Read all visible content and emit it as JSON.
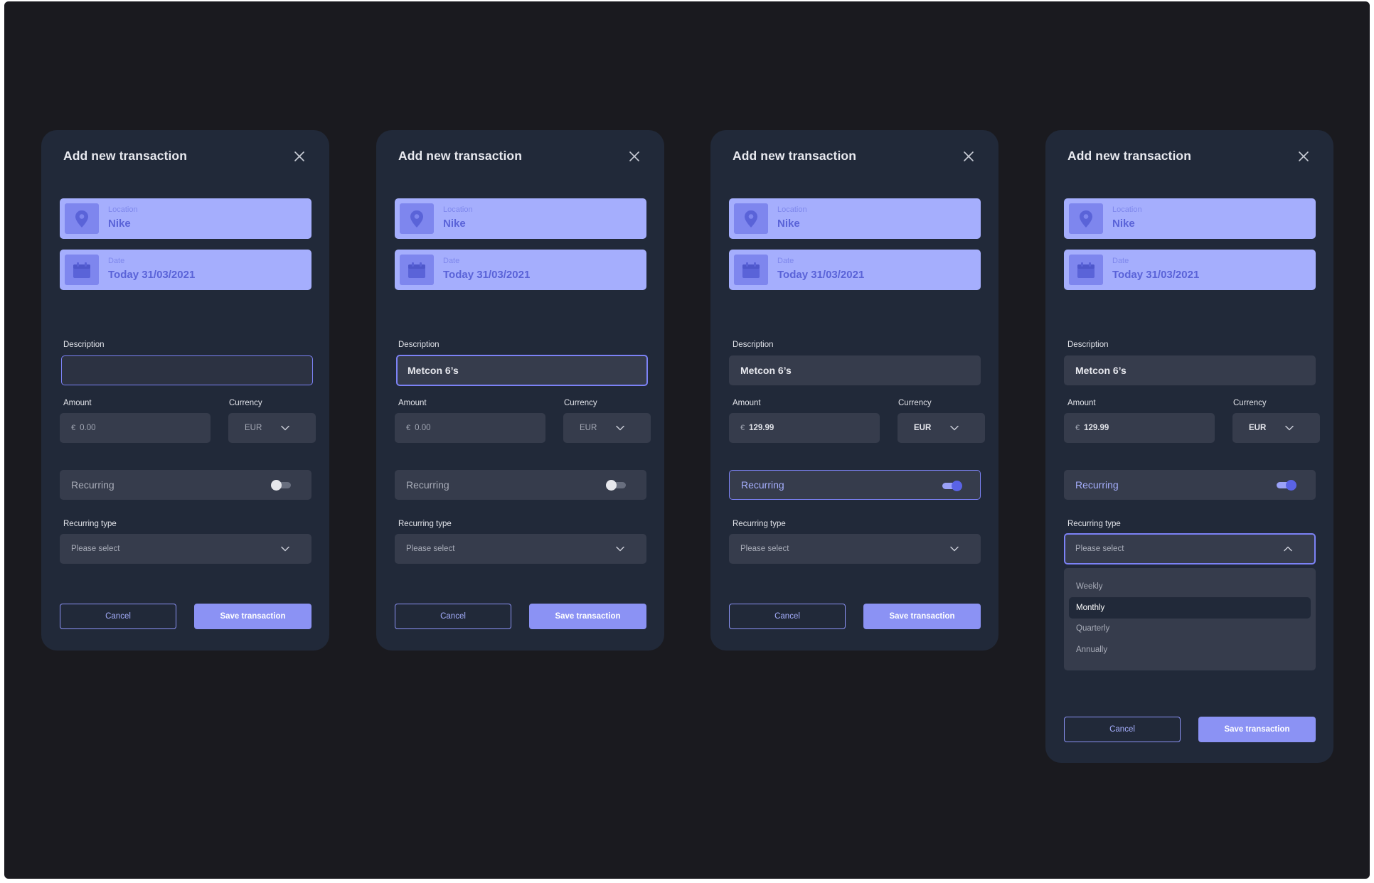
{
  "colors": {
    "background": "#1a1a1f",
    "card": "#212939",
    "field": "#363c4c",
    "accent": "#8b92f4",
    "tile": "#a5aefd",
    "tile_icon": "#7e86ee",
    "tile_text": "#5a63d8"
  },
  "cards": [
    {
      "title": "Add new transaction",
      "close_icon": "close-icon",
      "location": {
        "label": "Location",
        "value": "Nike",
        "icon": "map-pin-icon"
      },
      "date": {
        "label": "Date",
        "value": "Today 31/03/2021",
        "icon": "calendar-icon"
      },
      "description": {
        "label": "Description",
        "value": "",
        "state": "focused-empty"
      },
      "amount": {
        "label": "Amount",
        "currency_symbol": "€",
        "value": "0.00",
        "is_placeholder": true
      },
      "currency": {
        "label": "Currency",
        "value": "EUR"
      },
      "recurring": {
        "label": "Recurring",
        "enabled": false
      },
      "recurring_type": {
        "label": "Recurring type",
        "placeholder": "Please select",
        "open": false
      },
      "buttons": {
        "cancel": "Cancel",
        "save": "Save transaction"
      }
    },
    {
      "title": "Add new transaction",
      "close_icon": "close-icon",
      "location": {
        "label": "Location",
        "value": "Nike",
        "icon": "map-pin-icon"
      },
      "date": {
        "label": "Date",
        "value": "Today 31/03/2021",
        "icon": "calendar-icon"
      },
      "description": {
        "label": "Description",
        "value": "Metcon 6’s",
        "state": "focused"
      },
      "amount": {
        "label": "Amount",
        "currency_symbol": "€",
        "value": "0.00",
        "is_placeholder": true
      },
      "currency": {
        "label": "Currency",
        "value": "EUR"
      },
      "recurring": {
        "label": "Recurring",
        "enabled": false
      },
      "recurring_type": {
        "label": "Recurring type",
        "placeholder": "Please select",
        "open": false
      },
      "buttons": {
        "cancel": "Cancel",
        "save": "Save transaction"
      }
    },
    {
      "title": "Add new transaction",
      "close_icon": "close-icon",
      "location": {
        "label": "Location",
        "value": "Nike",
        "icon": "map-pin-icon"
      },
      "date": {
        "label": "Date",
        "value": "Today 31/03/2021",
        "icon": "calendar-icon"
      },
      "description": {
        "label": "Description",
        "value": "Metcon 6’s",
        "state": "filled"
      },
      "amount": {
        "label": "Amount",
        "currency_symbol": "€",
        "value": "129.99",
        "is_placeholder": false
      },
      "currency": {
        "label": "Currency",
        "value": "EUR"
      },
      "recurring": {
        "label": "Recurring",
        "enabled": true
      },
      "recurring_type": {
        "label": "Recurring type",
        "placeholder": "Please select",
        "open": false
      },
      "buttons": {
        "cancel": "Cancel",
        "save": "Save transaction"
      }
    },
    {
      "title": "Add new transaction",
      "close_icon": "close-icon",
      "location": {
        "label": "Location",
        "value": "Nike",
        "icon": "map-pin-icon"
      },
      "date": {
        "label": "Date",
        "value": "Today 31/03/2021",
        "icon": "calendar-icon"
      },
      "description": {
        "label": "Description",
        "value": "Metcon 6’s",
        "state": "filled"
      },
      "amount": {
        "label": "Amount",
        "currency_symbol": "€",
        "value": "129.99",
        "is_placeholder": false
      },
      "currency": {
        "label": "Currency",
        "value": "EUR"
      },
      "recurring": {
        "label": "Recurring",
        "enabled": true
      },
      "recurring_type": {
        "label": "Recurring type",
        "placeholder": "Please select",
        "open": true,
        "options": [
          "Weekly",
          "Monthly",
          "Quarterly",
          "Annually"
        ],
        "highlighted": "Monthly"
      },
      "buttons": {
        "cancel": "Cancel",
        "save": "Save transaction"
      }
    }
  ]
}
